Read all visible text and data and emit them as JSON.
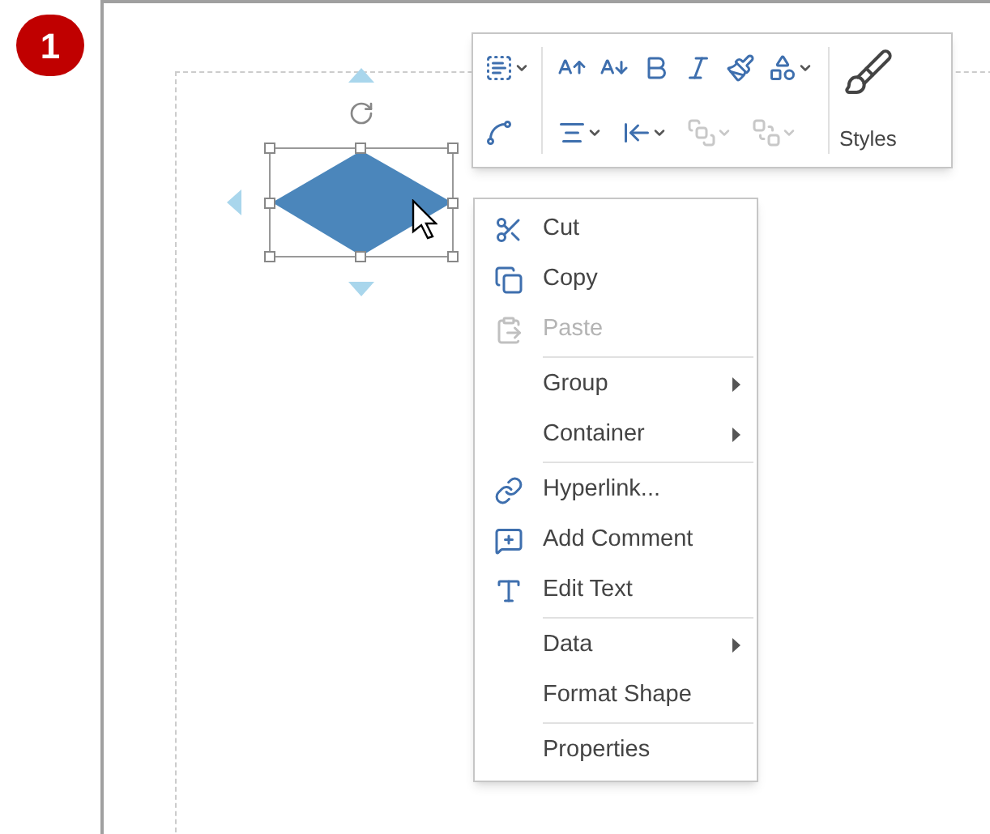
{
  "step_badge": "1",
  "mini_toolbar": {
    "styles_label": "Styles",
    "buttons": [
      {
        "disabled": false,
        "dropdown": true
      },
      {
        "disabled": false,
        "dropdown": false
      },
      {
        "disabled": false,
        "dropdown": false
      },
      {
        "disabled": false,
        "dropdown": false
      },
      {
        "disabled": false,
        "dropdown": false
      },
      {
        "disabled": false,
        "dropdown": false
      },
      {
        "disabled": false,
        "dropdown": false
      },
      {
        "disabled": false,
        "dropdown": true
      },
      {
        "disabled": false,
        "dropdown": true
      },
      {
        "disabled": false,
        "dropdown": true
      },
      {
        "disabled": true,
        "dropdown": true
      },
      {
        "disabled": true,
        "dropdown": true
      }
    ]
  },
  "context_menu": [
    {
      "kind": "item",
      "label": "Cut",
      "disabled": false,
      "submenu": false
    },
    {
      "kind": "item",
      "label": "Copy",
      "disabled": false,
      "submenu": false
    },
    {
      "kind": "item",
      "label": "Paste",
      "disabled": true,
      "submenu": false
    },
    {
      "kind": "separator"
    },
    {
      "kind": "item",
      "label": "Group",
      "disabled": false,
      "submenu": true
    },
    {
      "kind": "item",
      "label": "Container",
      "disabled": false,
      "submenu": true
    },
    {
      "kind": "separator"
    },
    {
      "kind": "item",
      "label": "Hyperlink...",
      "disabled": false,
      "submenu": false
    },
    {
      "kind": "item",
      "label": "Add Comment",
      "disabled": false,
      "submenu": false
    },
    {
      "kind": "item",
      "label": "Edit Text",
      "disabled": false,
      "submenu": false
    },
    {
      "kind": "separator"
    },
    {
      "kind": "item",
      "label": "Data",
      "disabled": false,
      "submenu": true
    },
    {
      "kind": "item",
      "label": "Format Shape",
      "disabled": false,
      "submenu": false
    },
    {
      "kind": "separator"
    },
    {
      "kind": "item",
      "label": "Properties",
      "disabled": false,
      "submenu": false
    }
  ]
}
